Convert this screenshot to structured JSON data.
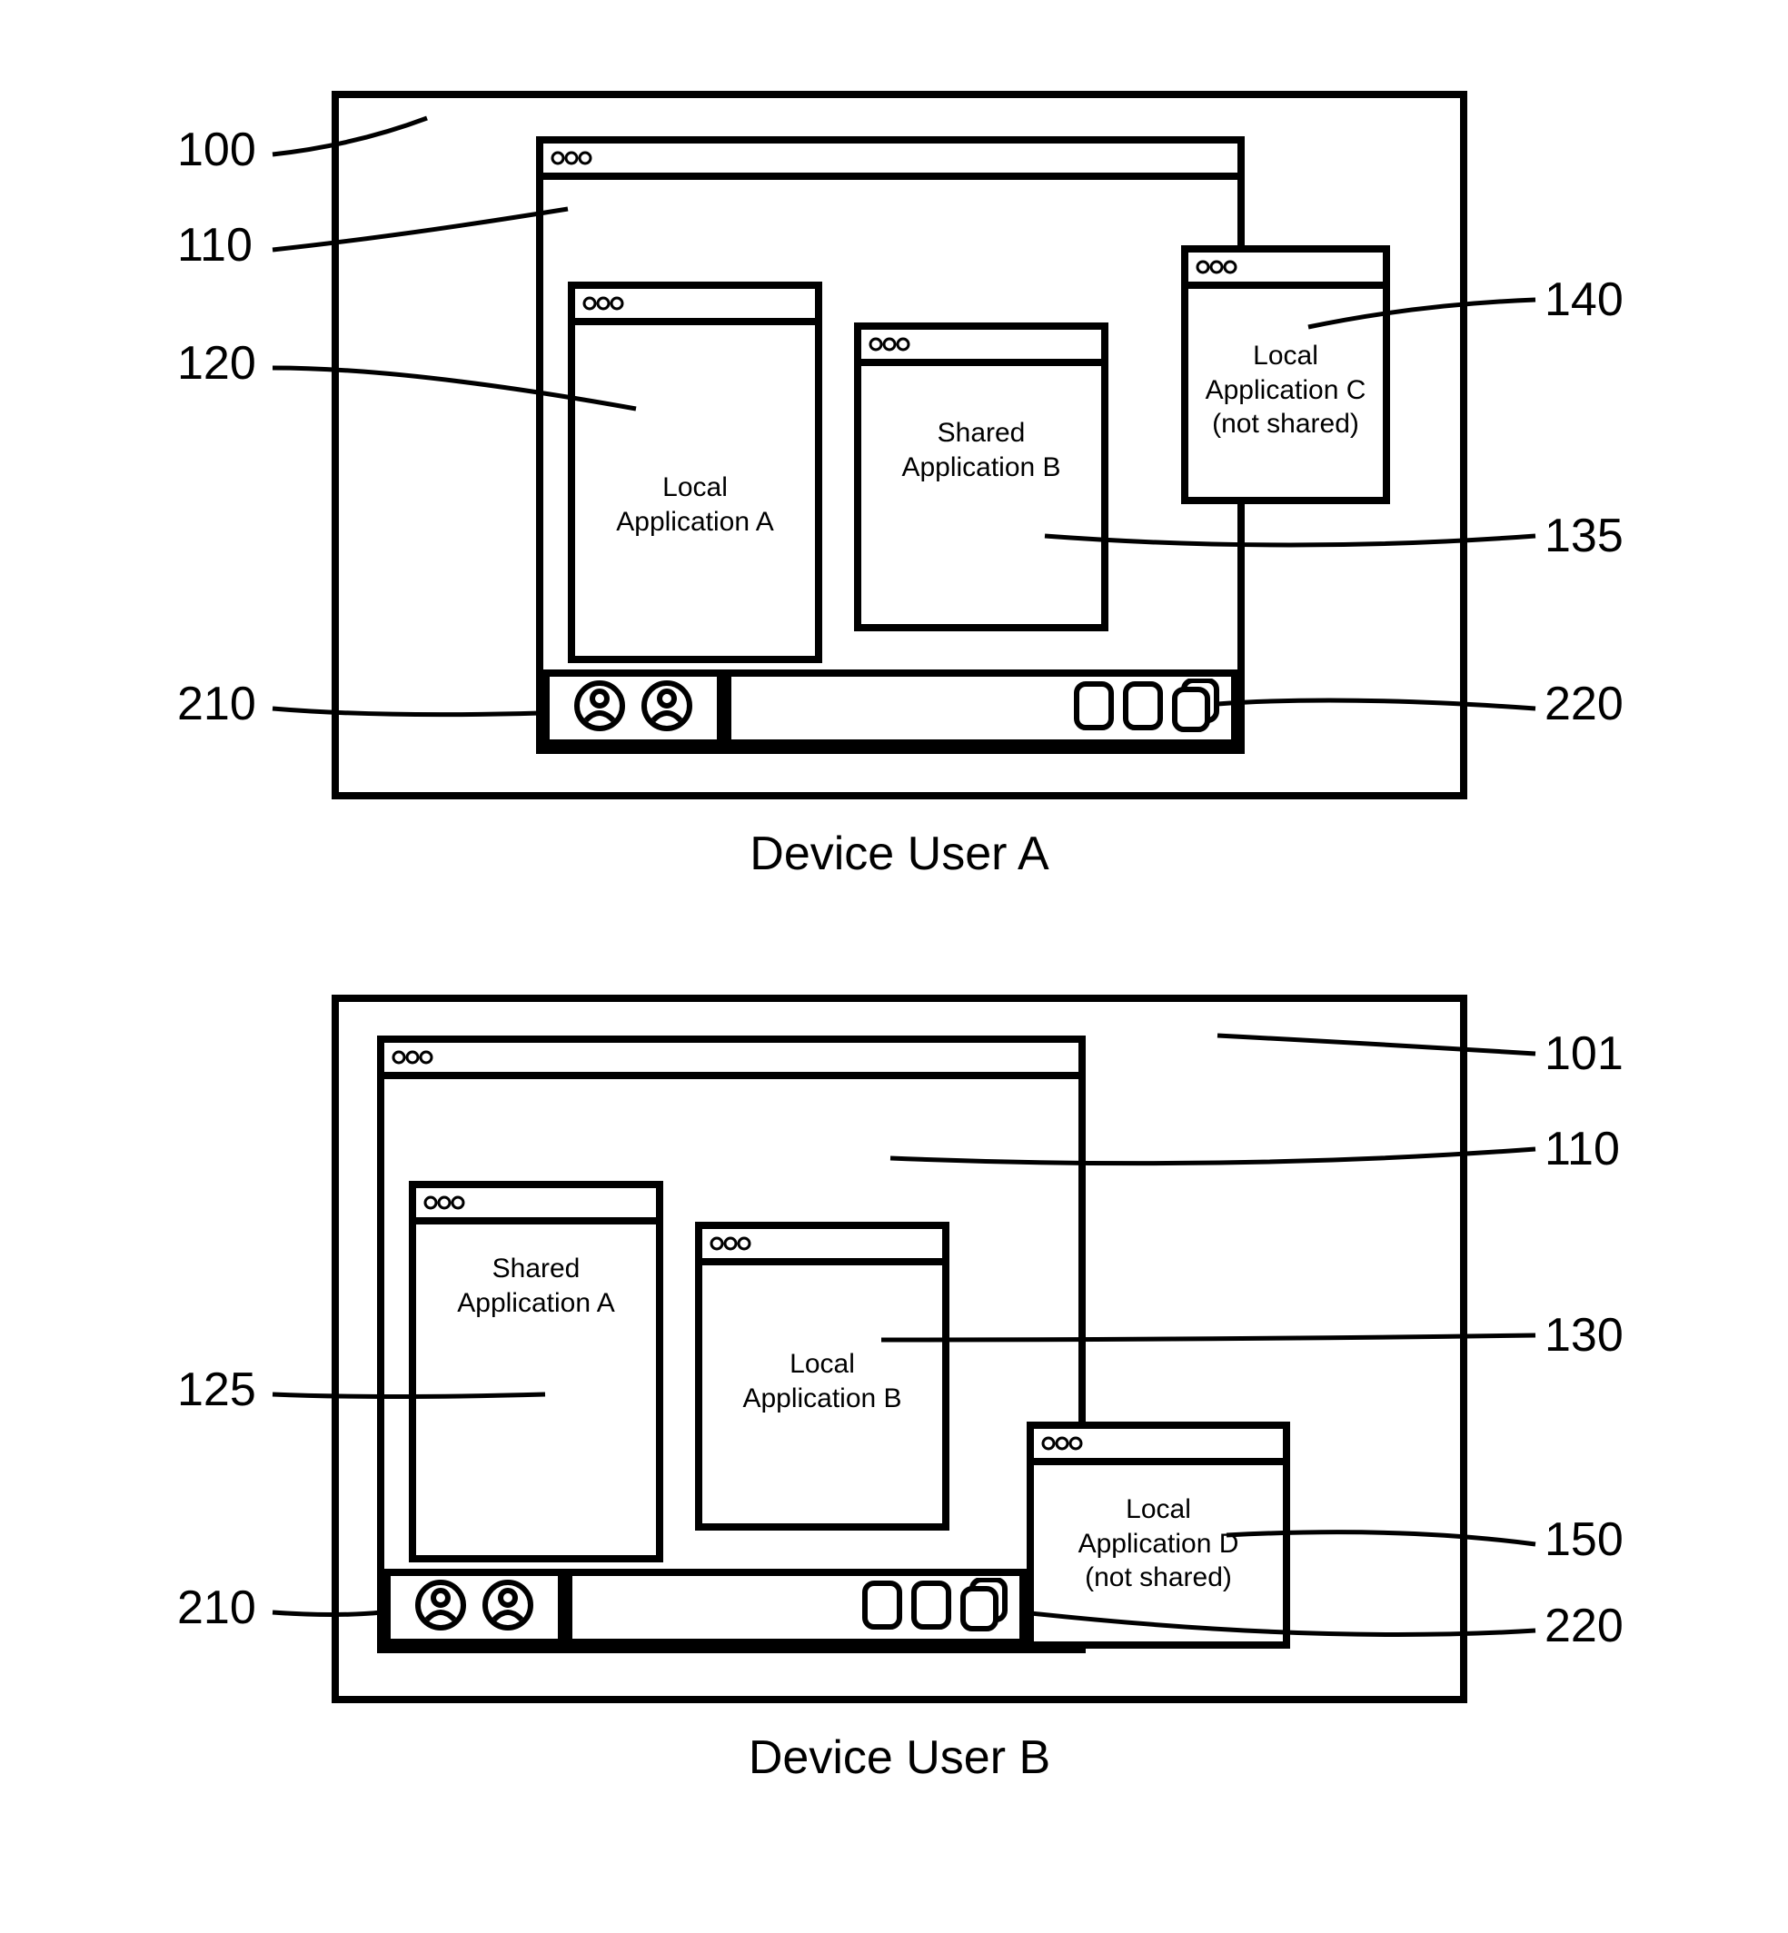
{
  "devices": {
    "a": {
      "caption": "Device User A",
      "windows": {
        "app_a": "Local\nApplication A",
        "app_b": "Shared\nApplication B",
        "app_c": "Local\nApplication C\n(not shared)"
      }
    },
    "b": {
      "caption": "Device User B",
      "windows": {
        "app_a": "Shared\nApplication A",
        "app_b": "Local\nApplication B",
        "app_d": "Local\nApplication D\n(not shared)"
      }
    }
  },
  "callouts": {
    "a": {
      "left": [
        "100",
        "110",
        "120",
        "210"
      ],
      "right": [
        "140",
        "135",
        "220"
      ]
    },
    "b": {
      "left": [
        "125",
        "210"
      ],
      "right": [
        "101",
        "110",
        "130",
        "150",
        "220"
      ]
    }
  }
}
